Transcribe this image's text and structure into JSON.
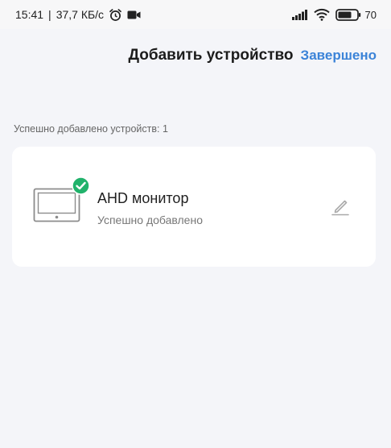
{
  "status_bar": {
    "time": "15:41",
    "separator": "|",
    "network_speed": "37,7 КБ/с",
    "battery": "70"
  },
  "header": {
    "title": "Добавить устройство",
    "done_label": "Завершено"
  },
  "summary": {
    "text": "Успешно добавлено устройств: 1"
  },
  "device": {
    "name": "AHD монитор",
    "status": "Успешно добавлено",
    "icon": "monitor-icon",
    "badge_icon": "check-icon"
  },
  "colors": {
    "accent": "#3b83d8",
    "success": "#21b26b",
    "background": "#f4f5f9",
    "card": "#ffffff"
  }
}
